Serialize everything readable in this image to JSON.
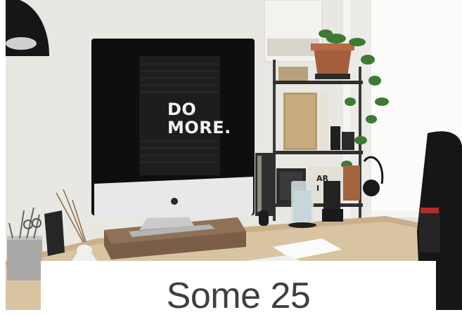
{
  "photo": {
    "screen_text_line1": "DO",
    "screen_text_line2": "MORE.",
    "book_text_line1": "AR",
    "book_text_line2": "I"
  },
  "caption": {
    "text": "Some 25"
  },
  "colors": {
    "wall": "#e8e7e2",
    "desk": "#d9c4a2",
    "monitor_bezel": "#111111",
    "monitor_chin": "#e8e8ea",
    "stand_base": "#7a5e48",
    "caption_text": "#3f3f3f"
  }
}
